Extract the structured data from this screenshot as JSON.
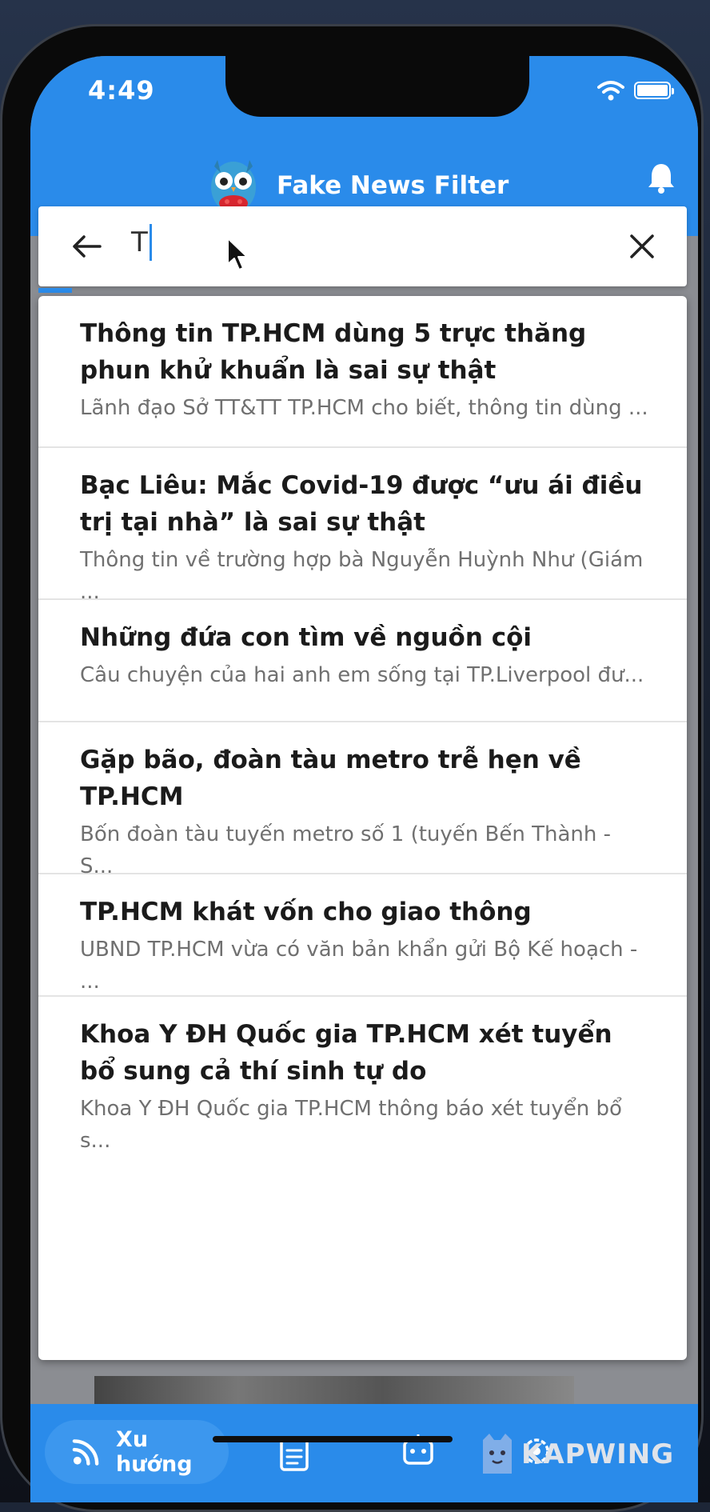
{
  "status_bar": {
    "time": "4:49"
  },
  "header": {
    "title": "Fake News Filter"
  },
  "search": {
    "query": "T"
  },
  "results": [
    {
      "title": "Thông tin TP.HCM dùng 5 trực thăng phun khử khuẩn là sai sự thật",
      "desc": "Lãnh đạo Sở TT&TT TP.HCM cho biết, thông tin dùng ..."
    },
    {
      "title": "Bạc Liêu: Mắc Covid-19 được “ưu ái điều trị tại nhà” là sai sự thật",
      "desc": "Thông tin về trường hợp bà Nguyễn Huỳnh Như (Giám ..."
    },
    {
      "title": "Những đứa con tìm về nguồn cội",
      "desc": "Câu chuyện của hai anh em sống tại TP.Liverpool đư..."
    },
    {
      "title": "Gặp bão, đoàn tàu metro trễ hẹn về TP.HCM",
      "desc": "Bốn đoàn tàu tuyến metro số 1 (tuyến Bến Thành - S..."
    },
    {
      "title": "TP.HCM khát vốn cho giao thông",
      "desc": "UBND TP.HCM vừa có văn bản khẩn gửi Bộ Kế hoạch - ..."
    },
    {
      "title": "Khoa Y ĐH Quốc gia TP.HCM xét tuyển bổ sung cả thí sinh tự do",
      "desc": "Khoa Y ĐH Quốc gia TP.HCM thông báo xét tuyển bổ s..."
    }
  ],
  "bottom_nav": {
    "trending_label": "Xu hướng"
  },
  "watermark": {
    "text": "KAPWING"
  },
  "colors": {
    "primary": "#2a8bea",
    "title_text": "#1b1b1b",
    "desc_text": "#707070"
  }
}
